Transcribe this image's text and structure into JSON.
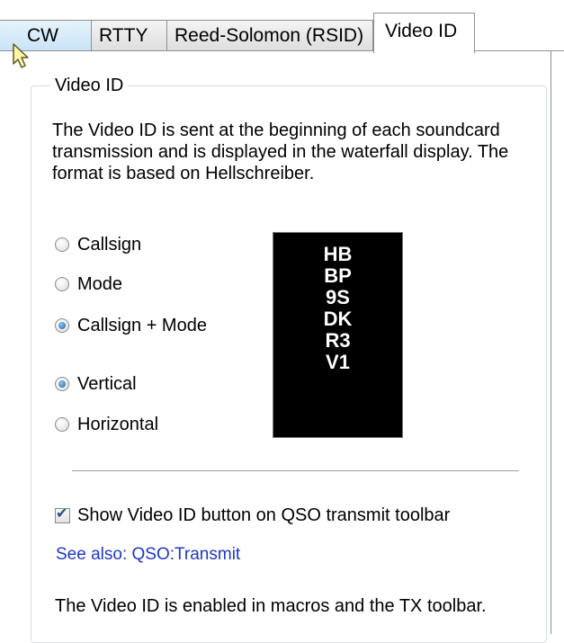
{
  "tabs": [
    {
      "label": "CW",
      "active": false
    },
    {
      "label": "RTTY",
      "active": false
    },
    {
      "label": "Reed-Solomon (RSID)",
      "active": false
    },
    {
      "label": "Video ID",
      "active": true
    }
  ],
  "group": {
    "title": "Video ID",
    "description": "The Video ID is sent at the beginning of each soundcard transmission and is displayed in the waterfall display. The format is based on Hellschreiber."
  },
  "content_options": [
    {
      "label": "Callsign",
      "checked": false
    },
    {
      "label": "Mode",
      "checked": false
    },
    {
      "label": "Callsign + Mode",
      "checked": true
    }
  ],
  "orientation_options": [
    {
      "label": "Vertical",
      "checked": true
    },
    {
      "label": "Horizontal",
      "checked": false
    }
  ],
  "preview": {
    "lines": [
      "HB",
      "BP",
      "9S",
      "DK",
      "R3",
      "V1"
    ]
  },
  "show_button_checkbox": {
    "label": "Show Video ID button on QSO transmit toolbar",
    "checked": true
  },
  "see_also_link": "See also: QSO:Transmit",
  "footer_note": "The Video ID is enabled in macros and the TX toolbar.",
  "colors": {
    "link": "#1f36c8",
    "radio_selected": "#1b5fa6",
    "preview_background": "#000000",
    "preview_text": "#ffffff"
  },
  "icons": {
    "cursor": "mouse-pointer-icon"
  }
}
